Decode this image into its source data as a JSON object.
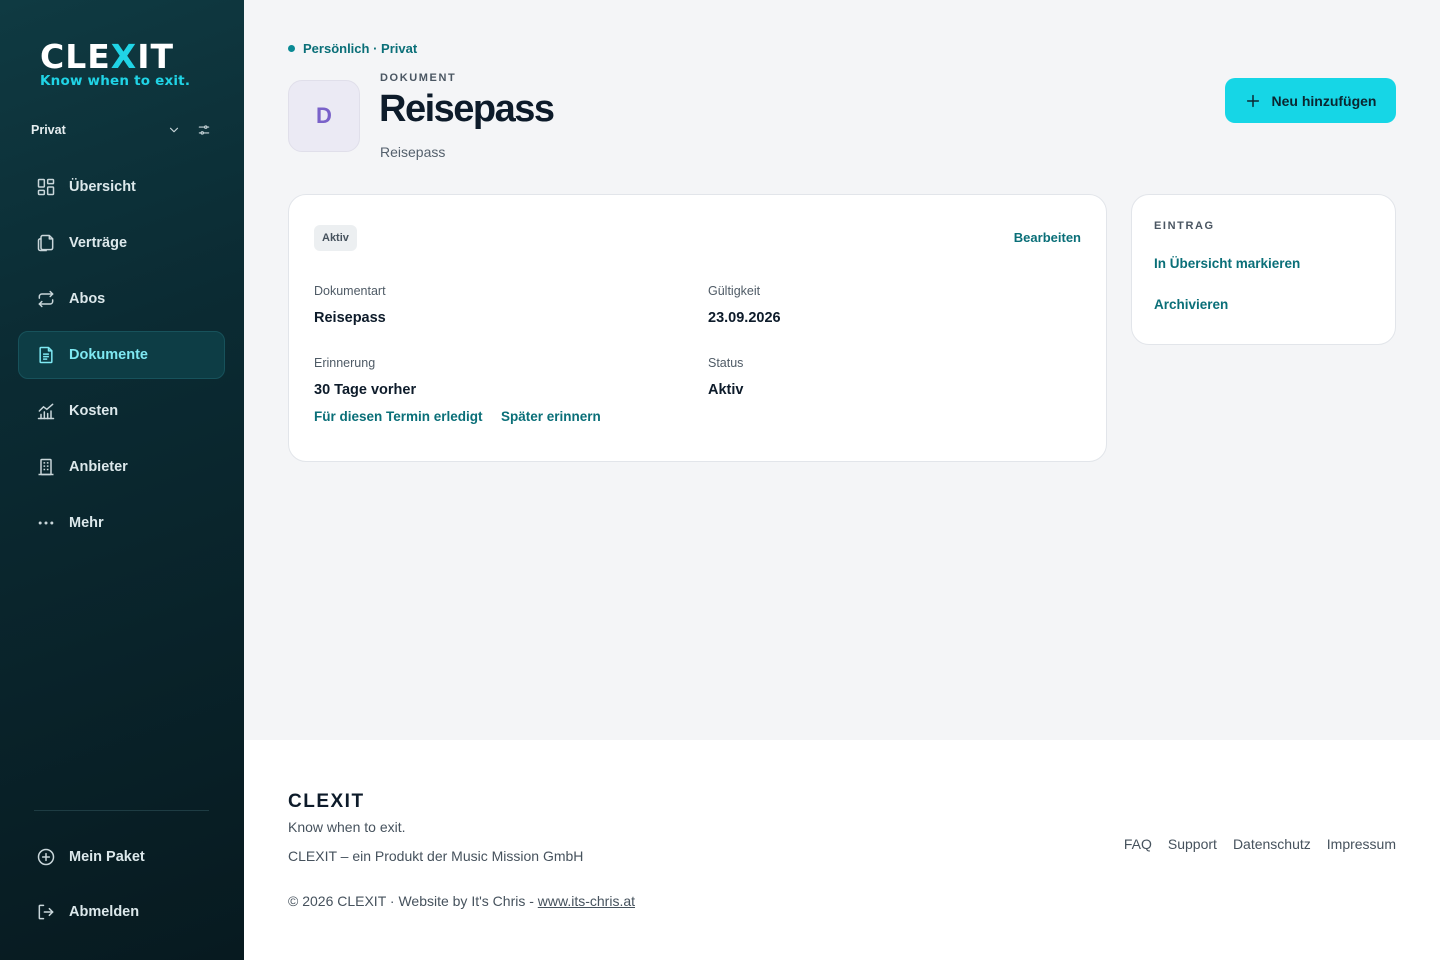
{
  "brand": {
    "logo_word_left": "CLE",
    "logo_word_x": "X",
    "logo_word_right": "IT",
    "tagline": "Know when to exit.",
    "accent_color": "#16d6e6"
  },
  "sidebar": {
    "space_selector": {
      "label": "Privat",
      "chevron_icon": "chevron-down-icon",
      "filter_icon": "sliders-icon"
    },
    "items": [
      {
        "label": "Übersicht",
        "icon": "dashboard-icon",
        "active": false
      },
      {
        "label": "Verträge",
        "icon": "documents-icon",
        "active": false
      },
      {
        "label": "Abos",
        "icon": "repeat-icon",
        "active": false
      },
      {
        "label": "Dokumente",
        "icon": "file-text-icon",
        "active": true
      },
      {
        "label": "Kosten",
        "icon": "chart-icon",
        "active": false
      },
      {
        "label": "Anbieter",
        "icon": "building-icon",
        "active": false
      },
      {
        "label": "Mehr",
        "icon": "more-icon",
        "active": false
      }
    ],
    "bottom_items": [
      {
        "label": "Mein Paket",
        "icon": "plus-circle-icon"
      },
      {
        "label": "Abmelden",
        "icon": "logout-icon"
      }
    ]
  },
  "header": {
    "breadcrumb": "Persönlich · Privat",
    "avatar_letter": "D",
    "kicker": "DOKUMENT",
    "title": "Reisepass",
    "subtitle": "Reisepass",
    "add_button_label": "Neu hinzufügen"
  },
  "details": {
    "status_badge": "Aktiv",
    "edit_label": "Bearbeiten",
    "fields": {
      "type_label": "Dokumentart",
      "type_value": "Reisepass",
      "validity_label": "Gültigkeit",
      "validity_value": "23.09.2026",
      "reminder_label": "Erinnerung",
      "reminder_value": "30 Tage vorher",
      "status_label": "Status",
      "status_value": "Aktiv"
    },
    "actions": {
      "done_label": "Für diesen Termin erledigt",
      "remind_later_label": "Später erinnern"
    }
  },
  "entry": {
    "kicker": "EINTRAG",
    "mark_label": "In Übersicht markieren",
    "archive_label": "Archivieren"
  },
  "footer": {
    "brand": "CLEXIT",
    "tagline": "Know when to exit.",
    "company": "CLEXIT – ein Produkt der Music Mission GmbH",
    "copyright": "© 2026 CLEXIT · Website by It's Chris - ",
    "website_link": "www.its-chris.at",
    "links": [
      "FAQ",
      "Support",
      "Datenschutz",
      "Impressum"
    ]
  }
}
